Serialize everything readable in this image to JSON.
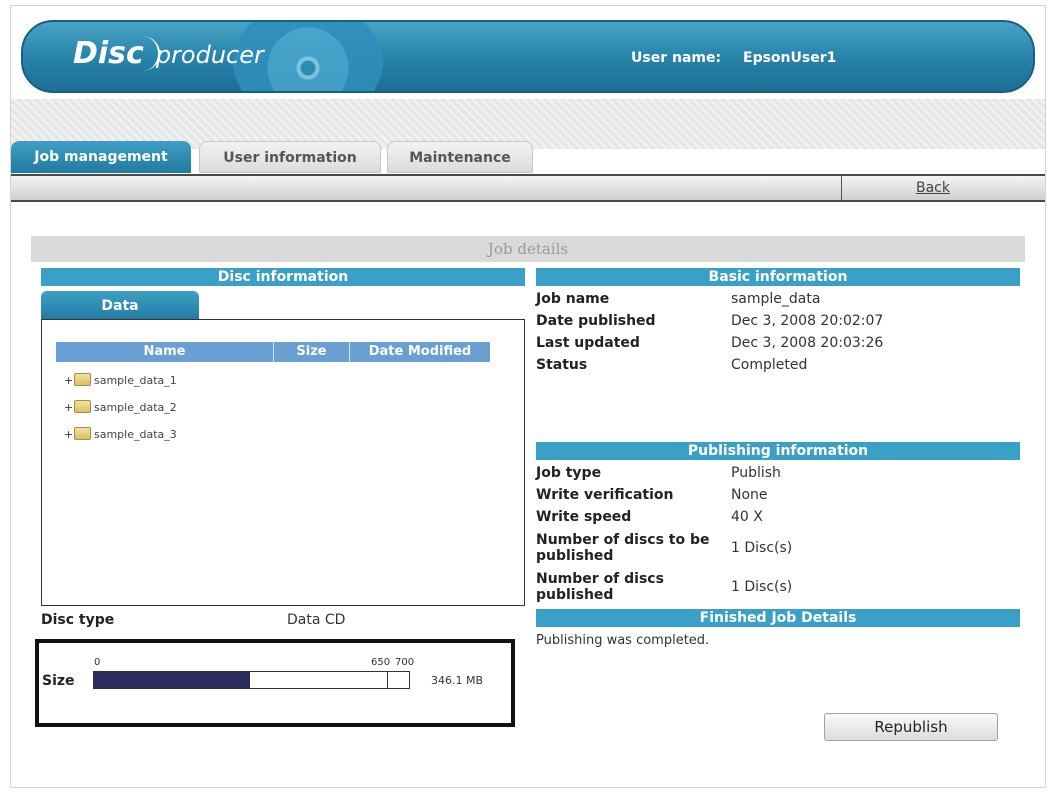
{
  "header": {
    "logo_disc": "Disc",
    "logo_producer": "producer",
    "user_label": "User name:",
    "user_name": "EpsonUser1"
  },
  "tabs": [
    {
      "label": "Job management",
      "active": true
    },
    {
      "label": "User information",
      "active": false
    },
    {
      "label": "Maintenance",
      "active": false
    }
  ],
  "nav": {
    "back_label": "Back"
  },
  "job_details_title": "Job details",
  "disc_info": {
    "heading": "Disc information",
    "data_tab": "Data",
    "columns": [
      "Name",
      "Size",
      "Date Modified"
    ],
    "folders": [
      "sample_data_1",
      "sample_data_2",
      "sample_data_3"
    ],
    "expander": "+",
    "disc_type_label": "Disc type",
    "disc_type_value": "Data CD",
    "size_label": "Size",
    "size_ticks": {
      "zero": "0",
      "mid": "650",
      "max": "700"
    },
    "size_value": "346.1 MB",
    "size_used_mb": 346.1,
    "size_capacity_mb": 700,
    "size_mark_mb": 650
  },
  "basic_info": {
    "heading": "Basic information",
    "rows": [
      {
        "label": "Job name",
        "value": "sample_data"
      },
      {
        "label": "Date published",
        "value": "Dec 3, 2008 20:02:07"
      },
      {
        "label": "Last updated",
        "value": "Dec 3, 2008 20:03:26"
      },
      {
        "label": "Status",
        "value": "Completed"
      }
    ]
  },
  "publishing_info": {
    "heading": "Publishing information",
    "rows": [
      {
        "label": "Job type",
        "value": "Publish"
      },
      {
        "label": "Write verification",
        "value": "None"
      },
      {
        "label": "Write speed",
        "value": "40 X"
      },
      {
        "label": "Number of discs to be published",
        "value": "1 Disc(s)"
      },
      {
        "label": "Number of discs published",
        "value": "1 Disc(s)"
      }
    ]
  },
  "finished": {
    "heading": "Finished Job Details",
    "text": "Publishing was completed."
  },
  "republish_label": "Republish",
  "colors": {
    "accent": "#3aa0c8",
    "header_bg": "#2a87ad",
    "size_fill": "#2b2b5e",
    "table_header": "#6a9fd4"
  }
}
